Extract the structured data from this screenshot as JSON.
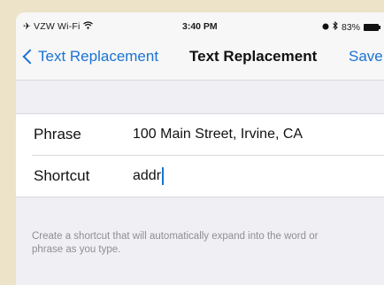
{
  "status_bar": {
    "carrier": "VZW Wi-Fi",
    "time": "3:40 PM",
    "battery": "83%"
  },
  "nav": {
    "back_label": "Text Replacement",
    "title": "Text Replacement",
    "save_label": "Save"
  },
  "form": {
    "phrase_label": "Phrase",
    "phrase_value": "100 Main Street, Irvine, CA",
    "shortcut_label": "Shortcut",
    "shortcut_value": "addr"
  },
  "footer_text": "Create a shortcut that will automatically expand into the word or phrase as you type."
}
